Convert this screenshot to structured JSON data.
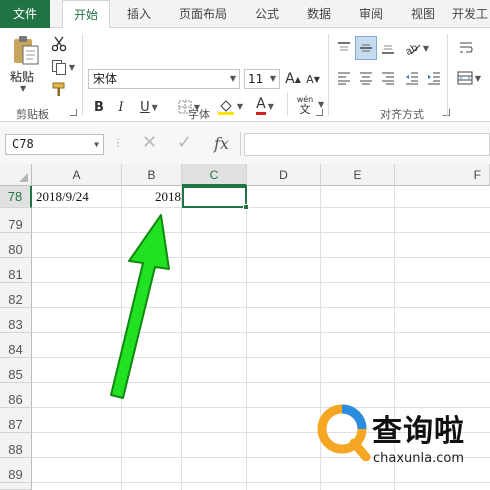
{
  "ribbon": {
    "tabs": [
      "文件",
      "开始",
      "插入",
      "页面布局",
      "公式",
      "数据",
      "审阅",
      "视图",
      "开发工"
    ],
    "clipboard": {
      "paste_label": "粘贴",
      "group_label": "剪贴板"
    },
    "font": {
      "name": "宋体",
      "size": "11",
      "group_label": "字体",
      "grow_label": "A",
      "shrink_label": "A",
      "bold_label": "B",
      "italic_label": "I",
      "underline_label": "U",
      "font_color_label": "A",
      "phonetic_top": "wén",
      "phonetic_bottom": "文"
    },
    "alignment": {
      "group_label": "对齐方式"
    }
  },
  "formula_bar": {
    "name_box": "C78",
    "fx_label": "fx",
    "cancel_symbol": "✕",
    "enter_symbol": "✓",
    "value": ""
  },
  "sheet": {
    "columns": [
      "A",
      "B",
      "C",
      "D",
      "E",
      "F"
    ],
    "rows": [
      "78",
      "79",
      "80",
      "81",
      "82",
      "83",
      "84",
      "85",
      "86",
      "87",
      "88",
      "89"
    ],
    "cells": {
      "A78": "2018/9/24",
      "B78": "2018"
    },
    "active_cell": "C78"
  },
  "annotation": {
    "arrow_color": "#22e022",
    "arrow_outline": "#0f8a0f"
  },
  "watermark": {
    "brand": "查询啦",
    "url": "chaxunla.com",
    "logo_orange": "#f5a623",
    "logo_blue": "#2a8de0"
  },
  "colors": {
    "accent": "#217346",
    "gridline": "#e0e0e0",
    "header_bg": "#f3f3f3"
  }
}
